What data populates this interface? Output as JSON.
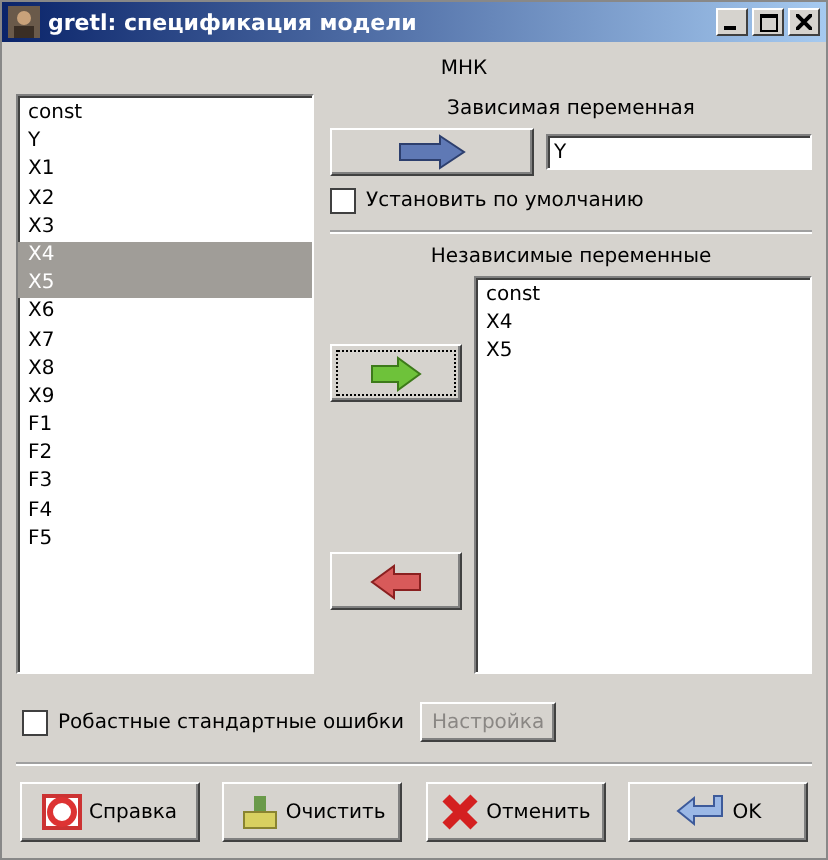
{
  "window": {
    "title": "gretl: спецификация модели"
  },
  "estimator": "МНК",
  "variables": [
    {
      "name": "const",
      "selected": false
    },
    {
      "name": "Y",
      "selected": false
    },
    {
      "name": "X1",
      "selected": false
    },
    {
      "name": "X2",
      "selected": false
    },
    {
      "name": "X3",
      "selected": false
    },
    {
      "name": "X4",
      "selected": true
    },
    {
      "name": "X5",
      "selected": true
    },
    {
      "name": "X6",
      "selected": false
    },
    {
      "name": "X7",
      "selected": false
    },
    {
      "name": "X8",
      "selected": false
    },
    {
      "name": "X9",
      "selected": false
    },
    {
      "name": "F1",
      "selected": false
    },
    {
      "name": "F2",
      "selected": false
    },
    {
      "name": "F3",
      "selected": false
    },
    {
      "name": "F4",
      "selected": false
    },
    {
      "name": "F5",
      "selected": false
    }
  ],
  "dependent": {
    "label": "Зависимая переменная",
    "value": "Y",
    "default_label": "Установить по умолчанию",
    "default_checked": false
  },
  "independent": {
    "label": "Независимые переменные",
    "items": [
      "const",
      "X4",
      "X5"
    ]
  },
  "robust": {
    "label": "Робастные стандартные ошибки",
    "checked": false,
    "config_button": "Настройка",
    "config_disabled": true
  },
  "buttons": [
    {
      "kind": "help",
      "label": "Справка"
    },
    {
      "kind": "clear",
      "label": "Очистить"
    },
    {
      "kind": "cancel",
      "label": "Отменить"
    },
    {
      "kind": "ok",
      "label": "OK"
    }
  ]
}
